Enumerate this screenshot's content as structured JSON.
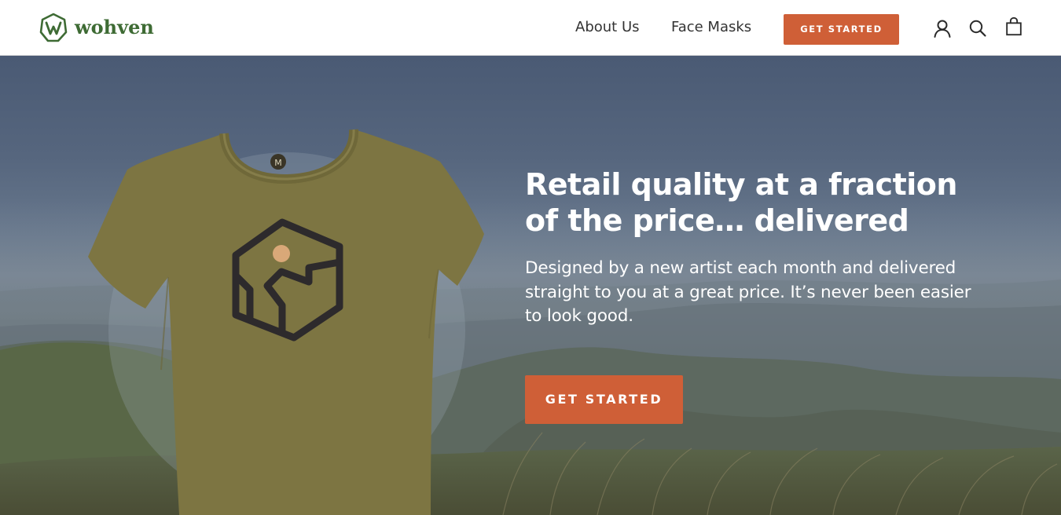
{
  "header": {
    "logo_text": "wohven",
    "nav": [
      {
        "label": "About Us"
      },
      {
        "label": "Face Masks"
      }
    ],
    "cta_label": "GET STARTED",
    "icons": [
      "account-icon",
      "search-icon",
      "cart-icon"
    ]
  },
  "hero": {
    "title": "Retail quality at a fraction of the price… delivered",
    "description": "Designed by a new artist each month and delivered straight to you at a great price. It’s never been easier to look good.",
    "cta_label": "GET STARTED",
    "shirt_tag_letter": "M"
  },
  "colors": {
    "brand_green": "#3e6b34",
    "accent_orange": "#cf5f37",
    "shirt_olive": "#7d7542"
  }
}
